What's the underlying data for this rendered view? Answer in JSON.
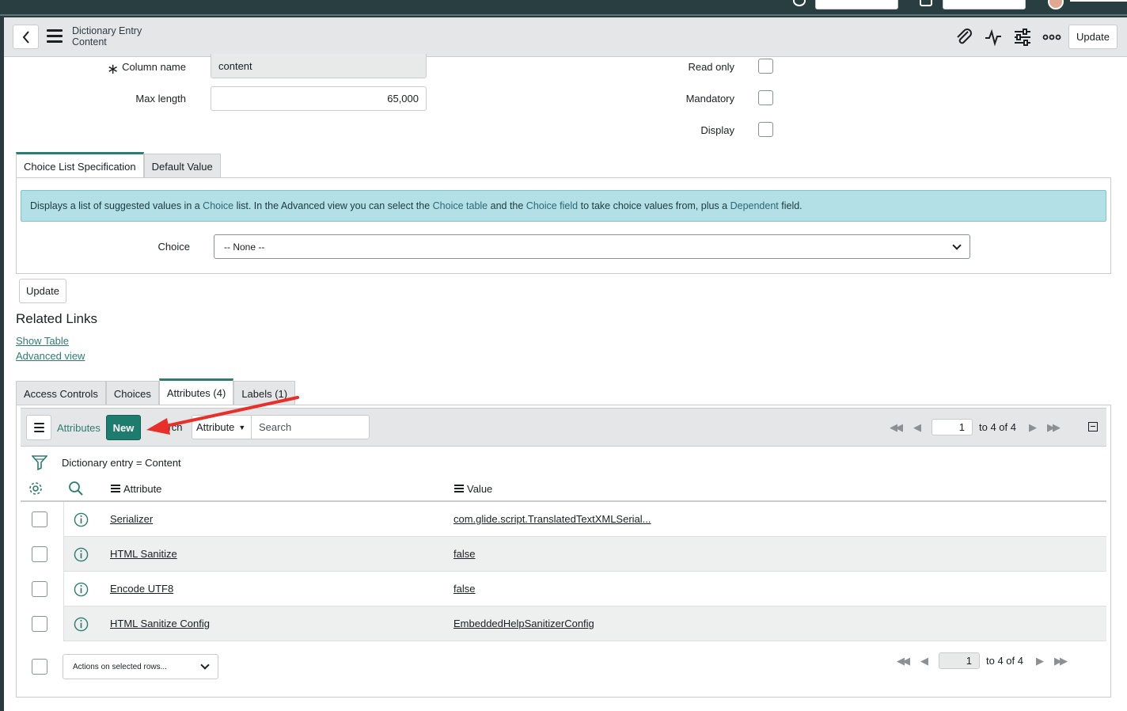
{
  "header": {
    "title_line1": "Dictionary Entry",
    "title_line2": "Content",
    "update_label": "Update"
  },
  "form": {
    "column_name_label": "Column name",
    "column_name_value": "content",
    "max_length_label": "Max length",
    "max_length_value": "65,000",
    "read_only_label": "Read only",
    "mandatory_label": "Mandatory",
    "display_label": "Display",
    "required_marker": "∗"
  },
  "section_tabs": [
    {
      "label": "Choice List Specification",
      "active": true
    },
    {
      "label": "Default Value",
      "active": false
    }
  ],
  "info": {
    "p1": "Displays a list of suggested values in a ",
    "h1": "Choice",
    "p2": " list. In the Advanced view you can select the ",
    "h2": "Choice table",
    "p3": " and the ",
    "h3": "Choice field",
    "p4": " to take choice values from, plus a ",
    "h4": "Dependent",
    "p5": " field."
  },
  "choice": {
    "label": "Choice",
    "value": "-- None --"
  },
  "update_button": "Update",
  "related_links": {
    "title": "Related Links",
    "show_table": "Show Table",
    "advanced_view": "Advanced view"
  },
  "related_tabs": [
    {
      "label": "Access Controls",
      "active": false
    },
    {
      "label": "Choices",
      "active": false
    },
    {
      "label": "Attributes (4)",
      "active": true
    },
    {
      "label": "Labels (1)",
      "active": false
    }
  ],
  "list": {
    "name": "Attributes",
    "new_label": "New",
    "search_label": "earch",
    "filter_field": "Attribute",
    "filter_field_arrow": "▼",
    "search_placeholder": "Search",
    "page": "1",
    "range": "to 4 of 4",
    "filter_text": "Dictionary entry = Content",
    "columns": [
      "Attribute",
      "Value"
    ],
    "rows": [
      {
        "attribute": "Serializer",
        "value": "com.glide.script.TranslatedTextXMLSerial..."
      },
      {
        "attribute": "HTML Sanitize",
        "value": "false"
      },
      {
        "attribute": "Encode UTF8",
        "value": "false"
      },
      {
        "attribute": "HTML Sanitize Config",
        "value": "EmbeddedHelpSanitizerConfig"
      }
    ],
    "actions_label": "Actions on selected rows..."
  },
  "colors": {
    "accent": "#2e7d72",
    "new_button": "#1e7c6e",
    "info_bg": "#b3dfe6",
    "arrow": "#e8302a"
  }
}
